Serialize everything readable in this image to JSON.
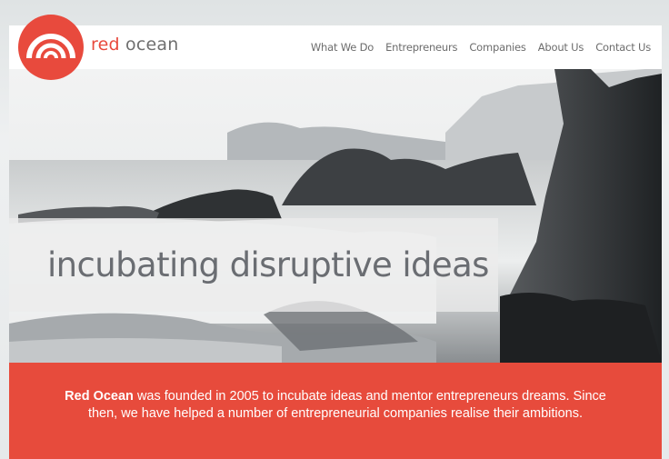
{
  "brand": {
    "name_part1": "red",
    "name_part2": "ocean",
    "accent_color": "#e84a3d",
    "logo_icon": "concentric-arcs-logo"
  },
  "nav": {
    "items": [
      {
        "label": "What We Do"
      },
      {
        "label": "Entrepreneurs"
      },
      {
        "label": "Companies"
      },
      {
        "label": "About Us"
      },
      {
        "label": "Contact Us"
      }
    ]
  },
  "hero": {
    "tagline": "incubating disruptive ideas",
    "image": "black-and-white-coastal-rocks-waves-photo"
  },
  "intro": {
    "company_name": "Red Ocean",
    "text_line1": "was founded in 2005 to incubate ideas and mentor entrepreneurs dreams. Since",
    "text_line2": "then, we have helped a number of entrepreneurial companies realise their ambitions."
  }
}
